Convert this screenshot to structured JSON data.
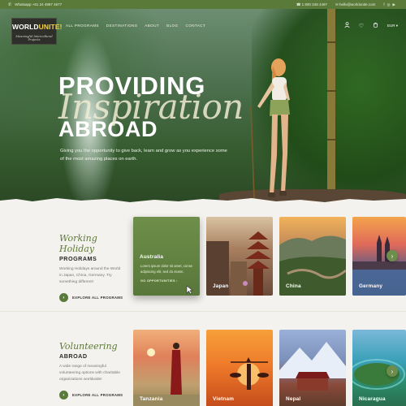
{
  "topbar": {
    "whatsapp": "Whatsapp +61 24 4987 4677",
    "phone": "1 800 348 4497",
    "email": "hello@worldunite.com",
    "currency": "EUR"
  },
  "brand": {
    "name_part1": "WORLD",
    "name_part2": "UNITE!",
    "tagline": "Meaningful Intercultural Projects"
  },
  "nav": [
    "ALL PROGRAMS",
    "DESTINATIONS",
    "ABOUT",
    "BLOG",
    "CONTACT"
  ],
  "hero": {
    "line1": "PROVIDING",
    "line2": "Inspiration",
    "line3": "ABROAD",
    "description": "Giving you the opportunity to give back, learn and grow as you experience some of the most amazing places on earth."
  },
  "working_holiday": {
    "script_title": "Working Holiday",
    "title": "PROGRAMS",
    "description": "Working Holidays around the World in Japan, China, Germany. Try something different!",
    "explore_label": "EXPLORE ALL PROGRAMS",
    "cards": [
      {
        "name": "Australia",
        "description": "Lorem ipsum dolor sit amet, conse adipiscing elit, sed do eiusm.",
        "link": "GO OPPORTUNITIES"
      },
      {
        "name": "Japan"
      },
      {
        "name": "China"
      },
      {
        "name": "Germany"
      }
    ]
  },
  "volunteering": {
    "script_title": "Volunteering",
    "title": "ABROAD",
    "description": "A wide range of meaningful volunteering options with charitable organizations worldwide!",
    "explore_label": "EXPLORE ALL PROGRAMS",
    "cards": [
      {
        "name": "Tanzania"
      },
      {
        "name": "Vietnam"
      },
      {
        "name": "Nepal"
      },
      {
        "name": "Nicaragua"
      }
    ]
  },
  "colors": {
    "brand_green": "#5a7a3a",
    "accent_yellow": "#f4d24a"
  }
}
